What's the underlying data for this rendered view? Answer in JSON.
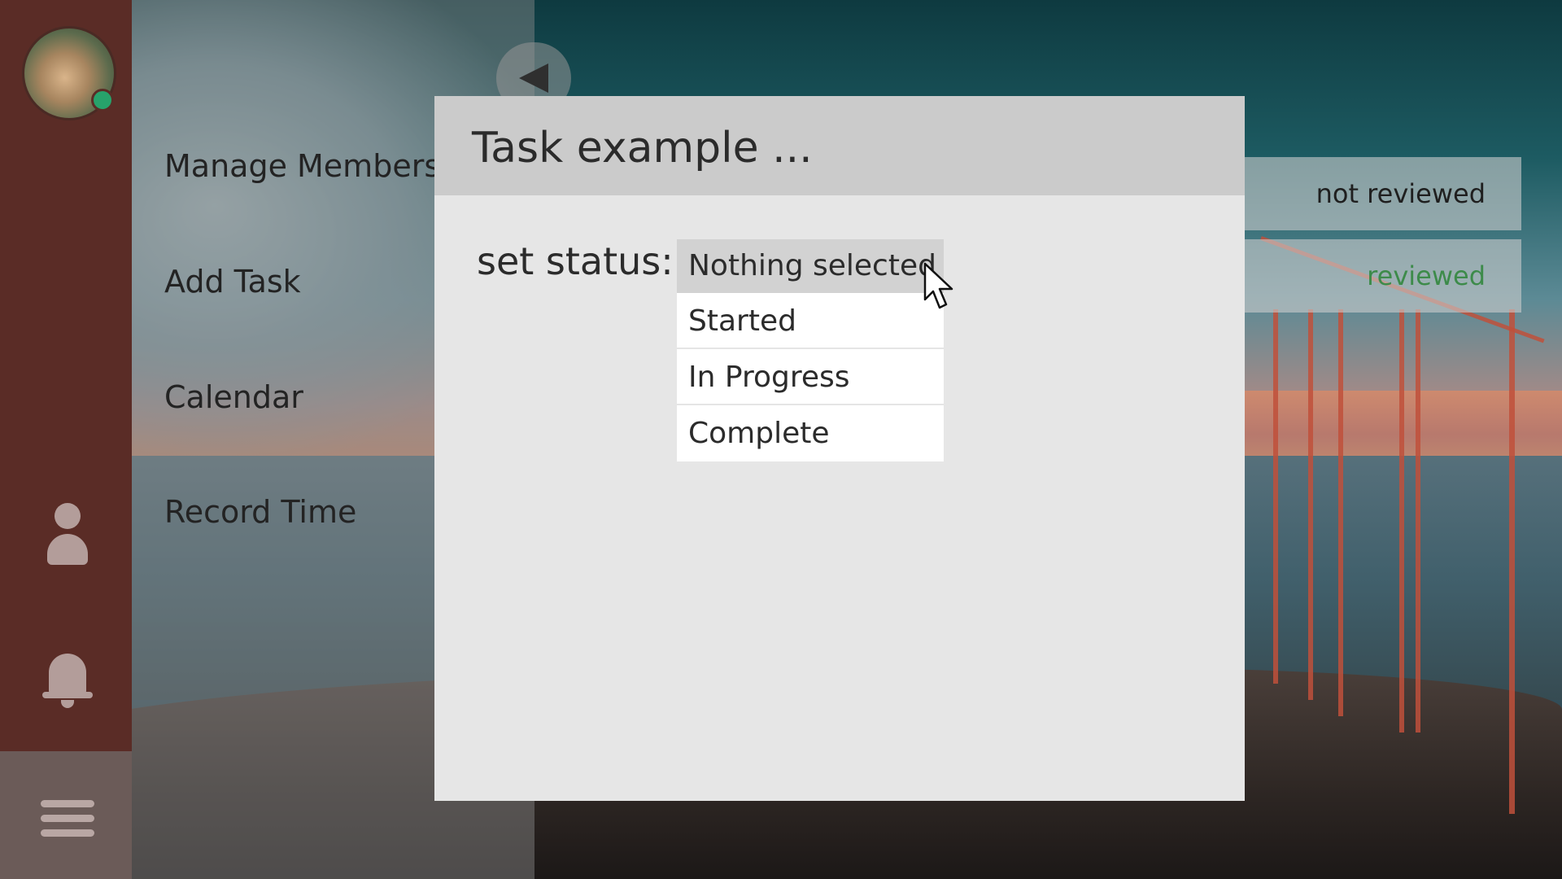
{
  "modal": {
    "title": "Task example  ...",
    "status_label": "set status:",
    "select": {
      "value": "Nothing selected",
      "options": [
        "Started",
        "In Progress",
        "Complete"
      ]
    }
  },
  "nav": {
    "items": [
      "Manage Members",
      "Add Task",
      "Calendar",
      "Record Time"
    ]
  },
  "review_list": [
    {
      "label": "not reviewed",
      "color": "#1f1f1f"
    },
    {
      "label": "reviewed",
      "color": "#3d8b4a"
    }
  ],
  "sidebar": {
    "icons": [
      "user-icon",
      "bell-icon",
      "hamburger-menu-icon"
    ],
    "presence_color": "#27a26b"
  }
}
